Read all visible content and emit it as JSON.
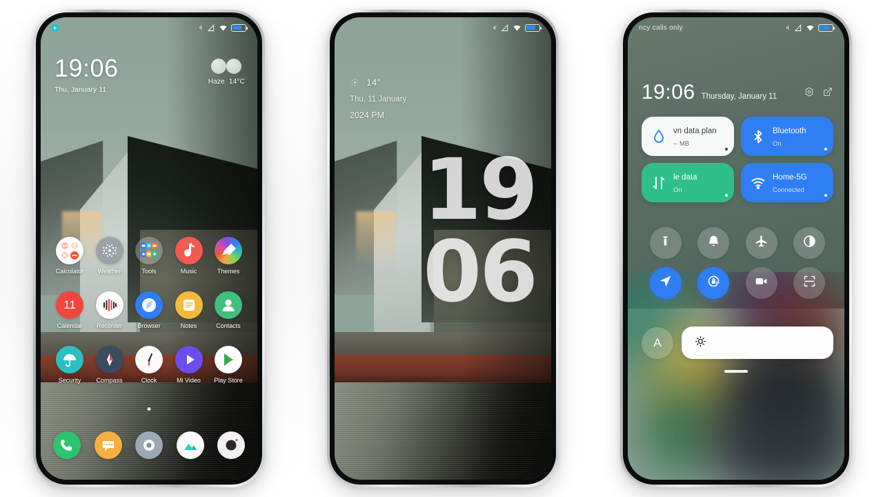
{
  "background": {
    "color": "#ffffff"
  },
  "phones": [
    {
      "id": "phone-home",
      "status_bar": {
        "icons": [
          "bluetooth-icon",
          "signal-icon",
          "wifi-icon",
          "battery-icon"
        ],
        "notification_badge": "notification-dot"
      },
      "clock": {
        "time": "19:06",
        "date": "Thu, January 11"
      },
      "weather": {
        "icon": "haze-icon",
        "condition": "Haze",
        "temperature": "14°C"
      },
      "app_rows": [
        [
          {
            "label": "Calculator",
            "icon": "calculator-icon"
          },
          {
            "label": "Weather",
            "icon": "weather-icon"
          },
          {
            "label": "Tools",
            "icon": "tools-folder-icon"
          },
          {
            "label": "Music",
            "icon": "music-icon"
          },
          {
            "label": "Themes",
            "icon": "themes-icon"
          }
        ],
        [
          {
            "label": "Calendar",
            "icon": "calendar-icon",
            "badge": "11"
          },
          {
            "label": "Recorder",
            "icon": "recorder-icon"
          },
          {
            "label": "Browser",
            "icon": "browser-icon"
          },
          {
            "label": "Notes",
            "icon": "notes-icon"
          },
          {
            "label": "Contacts",
            "icon": "contacts-icon"
          }
        ],
        [
          {
            "label": "Security",
            "icon": "security-icon"
          },
          {
            "label": "Compass",
            "icon": "compass-icon"
          },
          {
            "label": "Clock",
            "icon": "clock-icon"
          },
          {
            "label": "Mi Video",
            "icon": "mi-video-icon"
          },
          {
            "label": "Play Store",
            "icon": "play-store-icon"
          }
        ]
      ],
      "dock": [
        {
          "name": "phone-app",
          "icon": "phone-icon"
        },
        {
          "name": "messages-app",
          "icon": "messages-icon"
        },
        {
          "name": "settings-app",
          "icon": "settings-icon"
        },
        {
          "name": "gallery-app",
          "icon": "gallery-icon"
        },
        {
          "name": "camera-app",
          "icon": "camera-icon"
        }
      ]
    },
    {
      "id": "phone-lockscreen",
      "status_bar": {
        "icons": [
          "bluetooth-icon",
          "signal-icon",
          "wifi-icon",
          "battery-icon"
        ]
      },
      "weather": {
        "icon": "sun-icon",
        "temperature": "14°"
      },
      "date": "Thu, 11 January",
      "period": "2024 PM",
      "big_clock": {
        "hours": "19",
        "minutes": "06"
      }
    },
    {
      "id": "phone-control-center",
      "status_bar": {
        "carrier": "ncy calls only",
        "icons": [
          "bluetooth-icon",
          "signal-icon",
          "wifi-icon",
          "battery-icon"
        ]
      },
      "header": {
        "time": "19:06",
        "date": "Thursday, January 11",
        "icons": [
          "settings-gear-icon",
          "edit-icon"
        ]
      },
      "tiles": [
        {
          "name": "data-plan-tile",
          "label": "vn data plan",
          "sub": "-- MB",
          "icon": "water-drop-icon",
          "style": "white"
        },
        {
          "name": "bluetooth-tile",
          "label": "Bluetooth",
          "sub": "On",
          "icon": "bluetooth-icon",
          "style": "blue"
        },
        {
          "name": "mobile-data-tile",
          "label": "le data",
          "sub": "On",
          "icon": "data-arrows-icon",
          "style": "green"
        },
        {
          "name": "wifi-tile",
          "label": "Home-5G",
          "sub": "Connected",
          "icon": "wifi-icon",
          "style": "blue"
        }
      ],
      "toggles": [
        {
          "name": "flashlight-toggle",
          "icon": "flashlight-icon",
          "active": false
        },
        {
          "name": "ringer-toggle",
          "icon": "bell-icon",
          "active": false
        },
        {
          "name": "airplane-mode-toggle",
          "icon": "airplane-icon",
          "active": false
        },
        {
          "name": "dark-mode-toggle",
          "icon": "contrast-icon",
          "active": false
        },
        {
          "name": "location-toggle",
          "icon": "location-arrow-icon",
          "active": true
        },
        {
          "name": "auto-rotate-toggle",
          "icon": "rotation-lock-icon",
          "active": true
        },
        {
          "name": "screen-recorder-toggle",
          "icon": "video-camera-icon",
          "active": false
        },
        {
          "name": "scanner-toggle",
          "icon": "scan-icon",
          "active": false
        },
        {
          "name": "auto-brightness-toggle",
          "icon": "letter-a-icon",
          "active": false
        }
      ],
      "brightness": {
        "name": "brightness-slider",
        "icon": "sun-brightness-icon",
        "value": 0
      }
    }
  ]
}
